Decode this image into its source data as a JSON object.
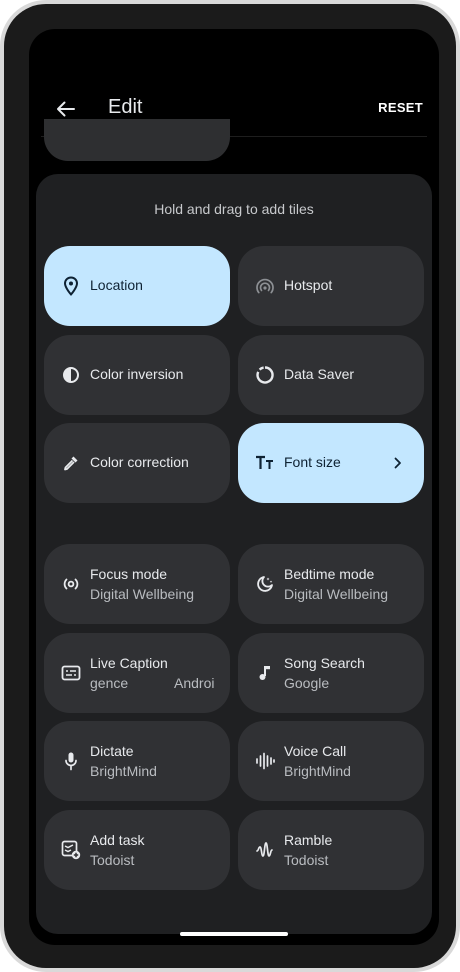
{
  "appbar": {
    "title": "Edit",
    "reset_label": "RESET"
  },
  "panel": {
    "hint": "Hold and drag to add tiles"
  },
  "tiles": {
    "location": {
      "label": "Location"
    },
    "hotspot": {
      "label": "Hotspot"
    },
    "color_inversion": {
      "label": "Color inversion"
    },
    "data_saver": {
      "label": "Data Saver"
    },
    "color_correction": {
      "label": "Color correction"
    },
    "font_size": {
      "label": "Font size"
    },
    "focus_mode": {
      "label": "Focus mode",
      "sub": "Digital Wellbeing"
    },
    "bedtime_mode": {
      "label": "Bedtime mode",
      "sub": "Digital Wellbeing"
    },
    "live_caption": {
      "label": "Live Caption",
      "sub_part1": "gence",
      "sub_part2": "Androi"
    },
    "song_search": {
      "label": "Song Search",
      "sub": "Google"
    },
    "dictate": {
      "label": "Dictate",
      "sub": "BrightMind"
    },
    "voice_call": {
      "label": "Voice Call",
      "sub": "BrightMind"
    },
    "add_task": {
      "label": "Add task",
      "sub": "Todoist"
    },
    "ramble": {
      "label": "Ramble",
      "sub": "Todoist"
    }
  },
  "colors": {
    "screen_bg": "#000000",
    "panel_bg": "#1f2022",
    "tile_bg": "#303134",
    "tile_active_bg": "#c3e7ff"
  },
  "icons": {
    "back": "arrow-back-icon",
    "location": "location-pin-icon",
    "hotspot": "hotspot-icon",
    "color_inversion": "color-inversion-icon",
    "data_saver": "data-saver-icon",
    "color_correction": "eyedropper-icon",
    "font_size": "font-size-icon",
    "focus_mode": "focus-mode-icon",
    "bedtime_mode": "bedtime-icon",
    "live_caption": "live-caption-icon",
    "song_search": "music-note-icon",
    "dictate": "microphone-icon",
    "voice_call": "waveform-icon",
    "add_task": "add-task-icon",
    "ramble": "ramble-icon"
  }
}
